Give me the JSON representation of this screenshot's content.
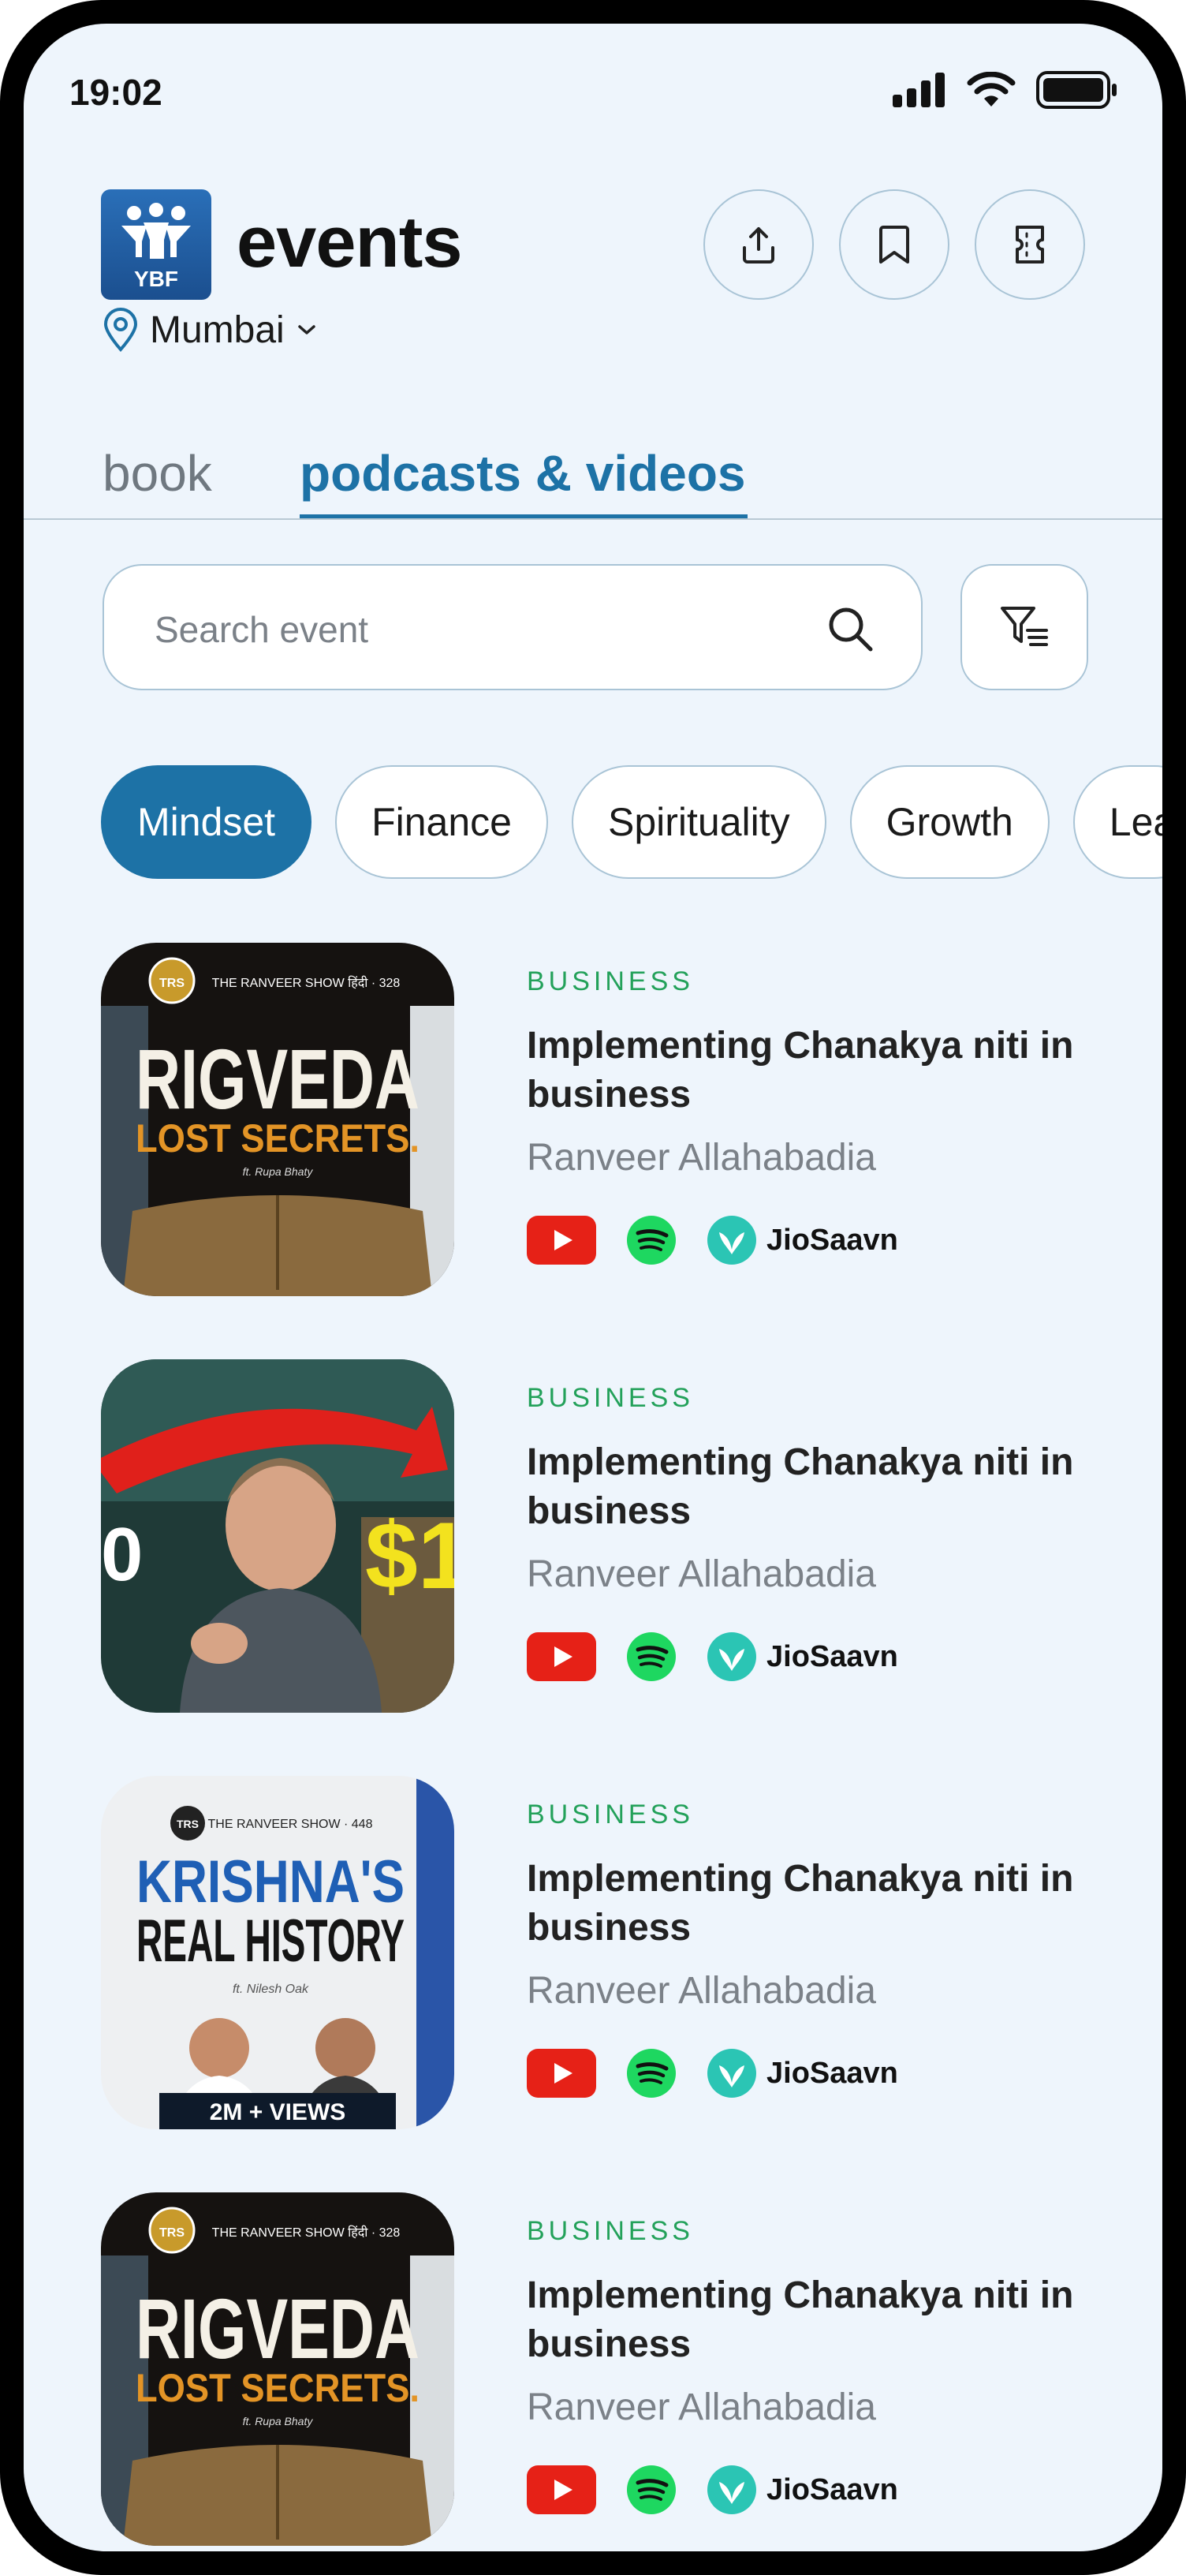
{
  "status": {
    "time": "19:02"
  },
  "header": {
    "logo_text": "YBF",
    "brand": "events",
    "location": "Mumbai"
  },
  "tabs": [
    {
      "label": "book",
      "active": false
    },
    {
      "label": "podcasts & videos",
      "active": true
    }
  ],
  "search": {
    "placeholder": "Search event"
  },
  "chips": [
    {
      "label": "Mindset",
      "active": true
    },
    {
      "label": "Finance",
      "active": false
    },
    {
      "label": "Spirituality",
      "active": false
    },
    {
      "label": "Growth",
      "active": false
    },
    {
      "label": "Lea",
      "active": false
    }
  ],
  "items": [
    {
      "thumb": {
        "top": "THE RANVEER SHOW हिंदी · 328",
        "main": "RIGVEDA",
        "sub": "LOST SECRETS.",
        "ft": "ft. Rupa Bhaty",
        "badge": "TRS"
      },
      "category": "BUSINESS",
      "title": "Implementing Chanakya niti in business",
      "author": "Ranveer Allahabadia",
      "platforms": {
        "jiosaavn": "JioSaavn"
      }
    },
    {
      "thumb": {
        "left_text": "0",
        "right_text": "$1"
      },
      "category": "BUSINESS",
      "title": "Implementing Chanakya niti in business",
      "author": "Ranveer Allahabadia",
      "platforms": {
        "jiosaavn": "JioSaavn"
      }
    },
    {
      "thumb": {
        "top": "THE RANVEER SHOW · 448",
        "main": "KRISHNA'S",
        "sub": "REAL HISTORY",
        "ft": "ft. Nilesh Oak",
        "views": "2M + VIEWS",
        "badge": "TRS"
      },
      "category": "BUSINESS",
      "title": "Implementing Chanakya niti in business",
      "author": "Ranveer Allahabadia",
      "platforms": {
        "jiosaavn": "JioSaavn"
      }
    },
    {
      "thumb": {
        "top": "THE RANVEER SHOW हिंदी · 328",
        "main": "RIGVEDA",
        "sub": "LOST SECRETS.",
        "ft": "ft. Rupa Bhaty",
        "badge": "TRS"
      },
      "category": "BUSINESS",
      "title": "Implementing Chanakya niti in business",
      "author": "Ranveer Allahabadia",
      "platforms": {
        "jiosaavn": "JioSaavn"
      }
    }
  ],
  "colors": {
    "accent": "#1d72a6",
    "category": "#23a15a",
    "background": "#eef5fc"
  }
}
